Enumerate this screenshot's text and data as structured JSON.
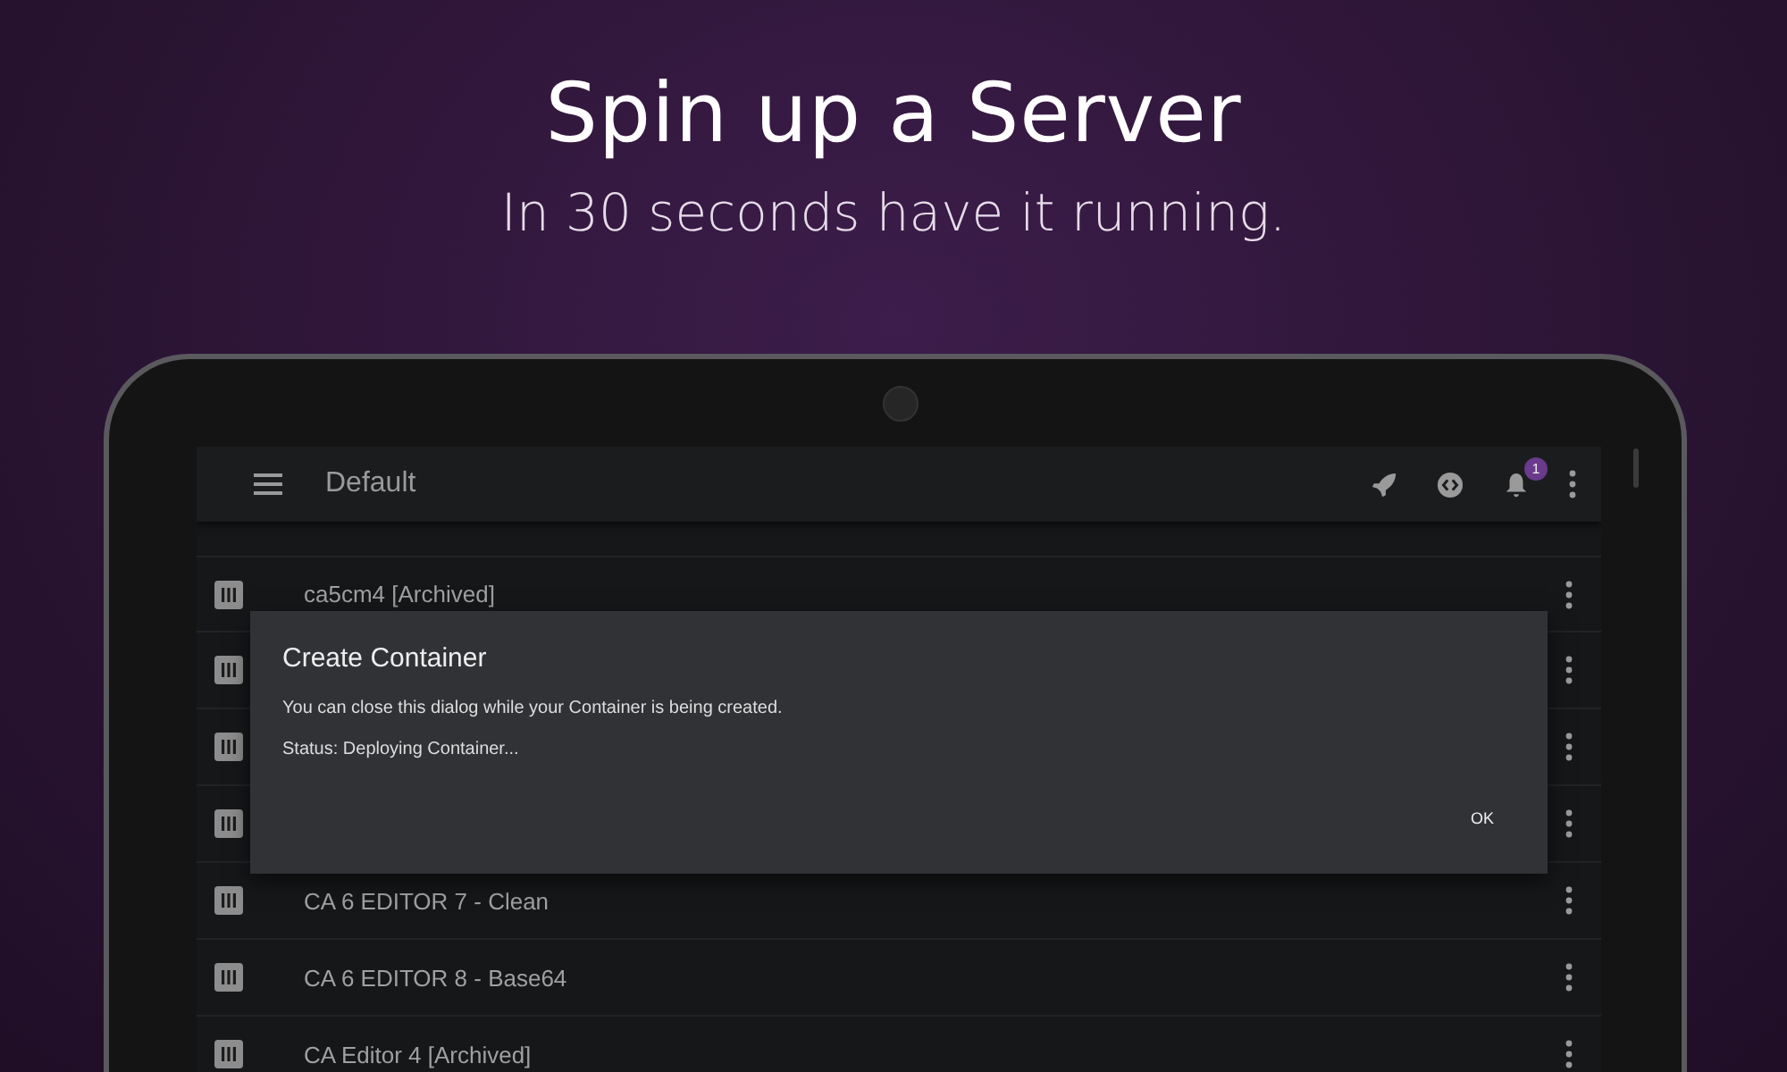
{
  "headline": "Spin up a Server",
  "subheadline": "In 30 seconds have it running.",
  "toolbar": {
    "title": "Default",
    "notification_count": "1"
  },
  "rows": [
    {
      "kind": "named",
      "name": "ca5cm4 [Archived]"
    },
    {
      "kind": "covered"
    },
    {
      "kind": "covered"
    },
    {
      "kind": "covered"
    },
    {
      "kind": "named",
      "name": "CA 6 EDITOR 7 - Clean"
    },
    {
      "kind": "named",
      "name": "CA 6 EDITOR 8 - Base64"
    },
    {
      "kind": "named",
      "name": "CA Editor 4 [Archived]"
    }
  ],
  "dialog": {
    "title": "Create Container",
    "message": "You can close this dialog while your Container is being created.",
    "status": "Status: Deploying Container...",
    "button": "OK"
  }
}
